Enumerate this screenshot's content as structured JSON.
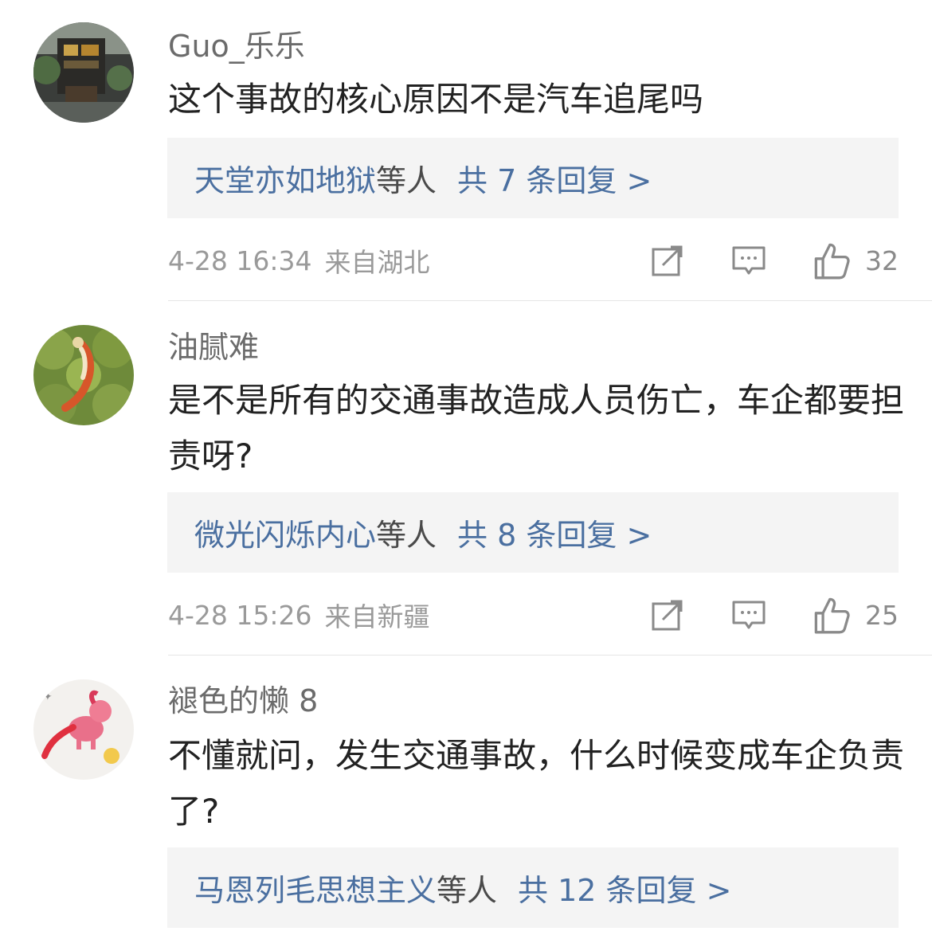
{
  "comments": [
    {
      "username": "Guo_乐乐",
      "text": "这个事故的核心原因不是汽车追尾吗",
      "replies": {
        "names": "天堂亦如地狱",
        "suffix": "等人",
        "count": "共 7 条回复 >"
      },
      "timestamp": "4-28 16:34",
      "location": "来自湖北",
      "likes": "32"
    },
    {
      "username": "油腻难",
      "text": "是不是所有的交通事故造成人员伤亡，车企都要担责呀?",
      "replies": {
        "names": "微光闪烁内心",
        "suffix": "等人",
        "count": "共 8 条回复 >"
      },
      "timestamp": "4-28 15:26",
      "location": "来自新疆",
      "likes": "25"
    },
    {
      "username": "褪色的懒 8",
      "text": "不懂就问，发生交通事故，什么时候变成车企负责了?",
      "replies": {
        "names": "马恩列毛思想主义",
        "suffix": "等人",
        "count": "共 12 条回复 >"
      }
    }
  ],
  "icons": {
    "share": "share-icon",
    "comment": "comment-icon",
    "like": "thumbs-up-icon"
  },
  "colors": {
    "link": "#4a6fa0",
    "text": "#222222",
    "muted": "#9a9a9a",
    "reply_bg": "#f4f4f4"
  }
}
